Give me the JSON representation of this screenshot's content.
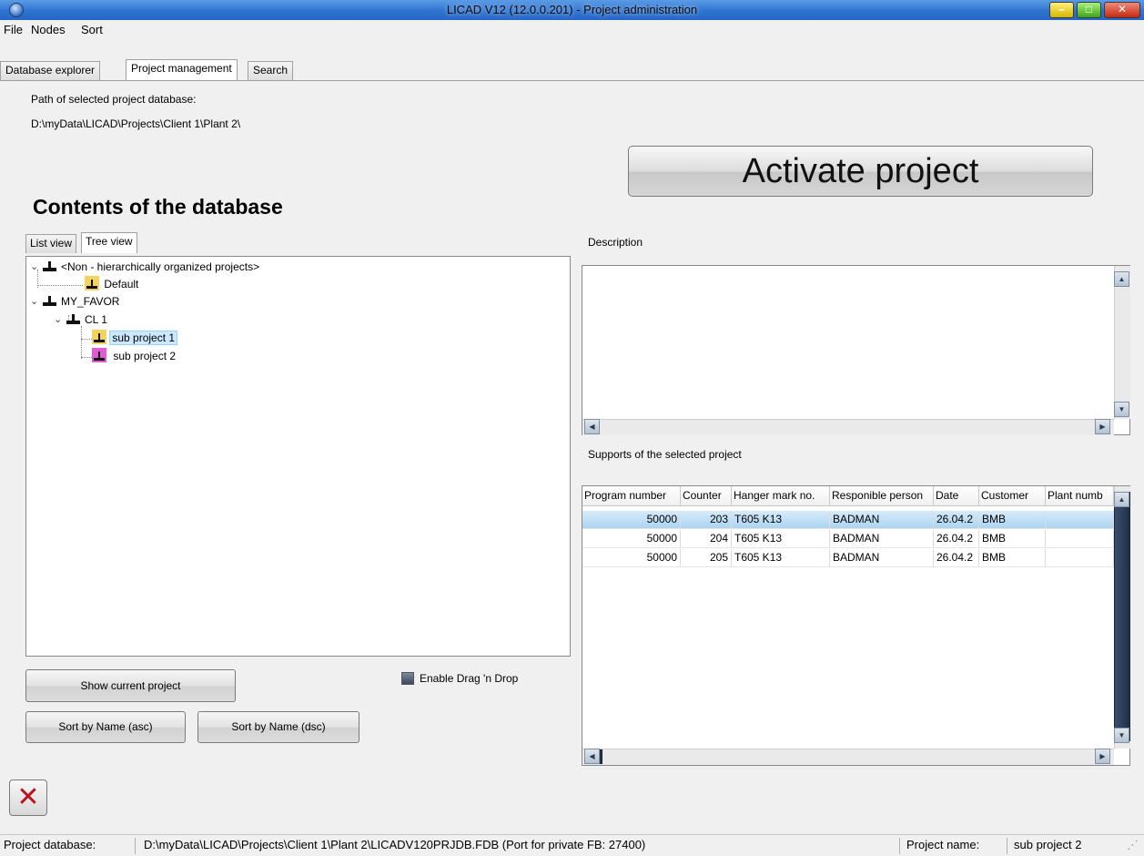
{
  "window": {
    "title": "LICAD V12 (12.0.0.201) - Project administration"
  },
  "menu": [
    "File",
    "Nodes",
    "Sort"
  ],
  "main_tabs": [
    "Database explorer",
    "Project management",
    "Search"
  ],
  "active_main_tab": "Project management",
  "path_label": "Path of selected project database:",
  "path_value": "D:\\myData\\LICAD\\Projects\\Client 1\\Plant 2\\",
  "activate_button": "Activate project",
  "contents_title": "Contents of the database",
  "sub_tabs": [
    "List view",
    "Tree view"
  ],
  "active_sub_tab": "Tree view",
  "tree": {
    "root1": "<Non - hierarchically organized projects>",
    "root1_child": "Default",
    "root2": "MY_FAVOR",
    "root2_child": "CL 1",
    "leaf1": "sub project 1",
    "leaf2": "sub project 2"
  },
  "buttons": {
    "show_current": "Show current project",
    "sort_asc": "Sort by Name (asc)",
    "sort_dsc": "Sort by Name (dsc)",
    "enable_dnd": "Enable Drag 'n Drop"
  },
  "description_label": "Description",
  "supports_label": "Supports of the selected project",
  "supports_table": {
    "columns": [
      "Program number",
      "Counter",
      "Hanger mark no.",
      "Responible person",
      "Date",
      "Customer",
      "Plant numb"
    ],
    "rows": [
      [
        "50000",
        "203",
        "T605 K13",
        "BADMAN",
        "26.04.2",
        "BMB",
        ""
      ],
      [
        "50000",
        "204",
        "T605 K13",
        "BADMAN",
        "26.04.2",
        "BMB",
        ""
      ],
      [
        "50000",
        "205",
        "T605 K13",
        "BADMAN",
        "26.04.2",
        "BMB",
        ""
      ]
    ]
  },
  "statusbar": {
    "db_label": "Project database:",
    "db_value": "D:\\myData\\LICAD\\Projects\\Client 1\\Plant 2\\LICADV120PRJDB.FDB (Port for private FB: 27400)",
    "name_label": "Project name:",
    "name_value": "sub project 2"
  },
  "colors": {
    "titlebar": "#2f73d0",
    "selection": "#cce8ff",
    "cancel_x": "#b8141c"
  }
}
